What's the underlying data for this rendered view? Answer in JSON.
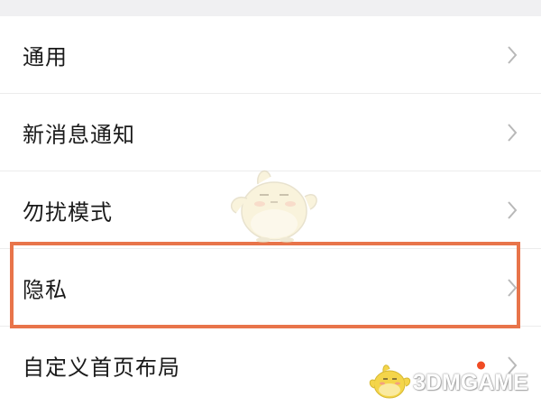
{
  "settings": {
    "items": [
      {
        "label": "通用",
        "icon": "chevron-right-icon"
      },
      {
        "label": "新消息通知",
        "icon": "chevron-right-icon"
      },
      {
        "label": "勿扰模式",
        "icon": "chevron-right-icon"
      },
      {
        "label": "隐私",
        "icon": "chevron-right-icon",
        "highlighted": true
      },
      {
        "label": "自定义首页布局",
        "icon": "chevron-right-icon",
        "badge": "red-dot"
      }
    ]
  },
  "watermark": {
    "text": "3DMGAME"
  },
  "colors": {
    "highlight_border": "#e8744a",
    "badge_dot": "#f04b24",
    "chevron": "#b8b8b8",
    "top_bar": "#f0f0f2",
    "divider": "#ececec"
  }
}
